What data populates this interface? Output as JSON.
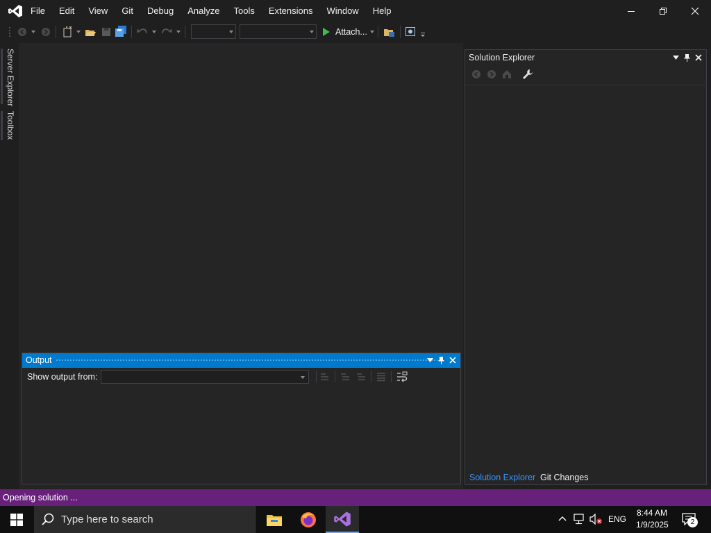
{
  "menu": [
    "File",
    "Edit",
    "View",
    "Git",
    "Debug",
    "Analyze",
    "Tools",
    "Extensions",
    "Window",
    "Help"
  ],
  "window_controls": {
    "minimize": "minimize-icon",
    "restore": "restore-icon",
    "close": "close-icon"
  },
  "toolbar": {
    "attach_label": "Attach...",
    "attach_icon": "play-icon"
  },
  "left_tabs": {
    "server_explorer": "Server Explorer",
    "toolbox": "Toolbox"
  },
  "output": {
    "title": "Output",
    "show_from_label": "Show output from:",
    "selected_source": ""
  },
  "solution_explorer": {
    "title": "Solution Explorer",
    "tabs": [
      "Solution Explorer",
      "Git Changes"
    ],
    "active_tab": 0
  },
  "status": {
    "text": "Opening solution ..."
  },
  "taskbar": {
    "search_placeholder": "Type here to search",
    "time": "8:44 AM",
    "date": "1/9/2025",
    "language": "ENG",
    "notifications": "2"
  },
  "colors": {
    "accent": "#007acc",
    "status": "#68217a",
    "logo": "#ffffff",
    "play": "#3fb950"
  }
}
